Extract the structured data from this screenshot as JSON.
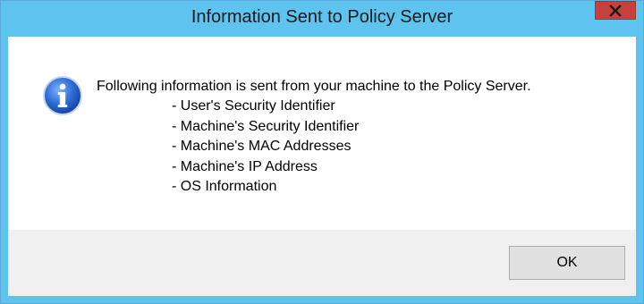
{
  "window": {
    "title": "Information Sent to Policy Server",
    "close_icon": "close-icon"
  },
  "dialog": {
    "icon": "info-icon",
    "message": "Following information is sent from your machine to the Policy Server.",
    "items": [
      "- User's Security Identifier",
      "- Machine's Security Identifier",
      "- Machine's MAC Addresses",
      "- Machine's IP Address",
      "- OS Information"
    ],
    "ok_label": "OK"
  },
  "colors": {
    "titlebar": "#5ec3ee",
    "close_button": "#c7403a",
    "button_area": "#f0f0f0",
    "icon_blue": "#2f6fd6"
  }
}
